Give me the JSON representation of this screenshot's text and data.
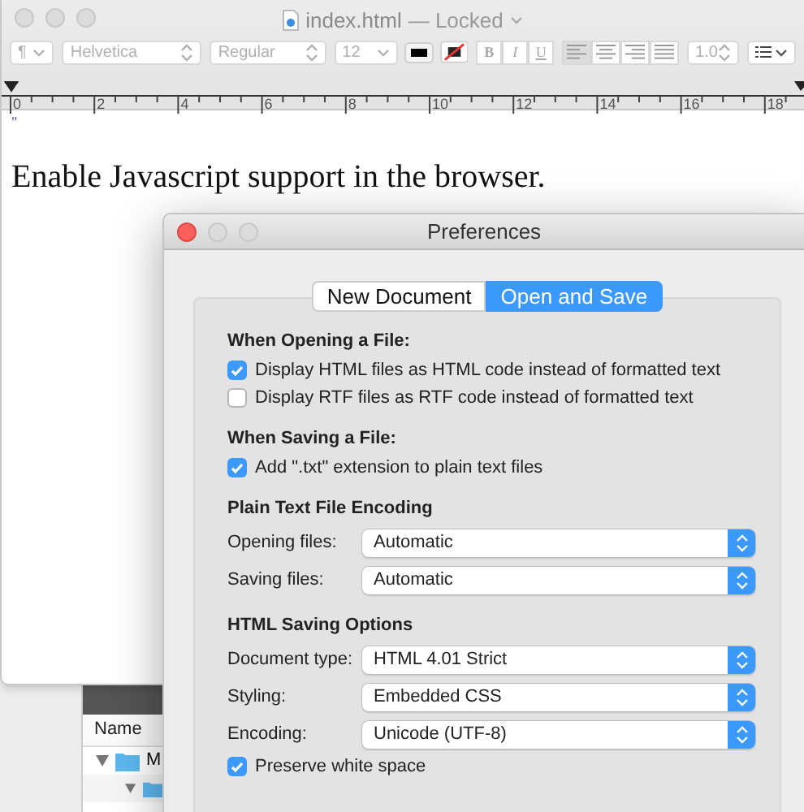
{
  "textedit": {
    "title": "index.html",
    "status": "— Locked",
    "toolbar": {
      "paragraph": "¶",
      "font": "Helvetica",
      "style": "Regular",
      "size": "12",
      "styles": [
        "B",
        "I",
        "U"
      ],
      "alignments": [
        {
          "selected": true
        },
        {
          "selected": false
        },
        {
          "selected": false
        },
        {
          "selected": false
        }
      ],
      "spacing": "1.0"
    },
    "ruler": [
      "0",
      "2",
      "4",
      "6",
      "8",
      "10",
      "12",
      "14",
      "16",
      "18"
    ],
    "lines": [
      "\"",
      "Enable Javascript support in the browser."
    ]
  },
  "finder": {
    "column": "Name",
    "tree": [
      {
        "name": "M",
        "expanded": true,
        "children": [
          {
            "expanded": true
          }
        ]
      }
    ]
  },
  "preferences": {
    "title": "Preferences",
    "tabs": [
      {
        "label": "New Document",
        "selected": false
      },
      {
        "label": "Open and Save",
        "selected": true
      }
    ],
    "sections": [
      {
        "heading": "When Opening a File:",
        "items": [
          {
            "kind": "checkbox",
            "label": "Display HTML files as HTML code instead of formatted text",
            "checked": true
          },
          {
            "kind": "checkbox",
            "label": "Display RTF files as RTF code instead of formatted text",
            "checked": false
          }
        ]
      },
      {
        "heading": "When Saving a File:",
        "items": [
          {
            "kind": "checkbox",
            "label": "Add \".txt\" extension to plain text files",
            "checked": true
          }
        ]
      },
      {
        "heading": "Plain Text File Encoding",
        "items": [
          {
            "kind": "popup",
            "label": "Opening files:",
            "value": "Automatic"
          },
          {
            "kind": "popup",
            "label": "Saving files:",
            "value": "Automatic"
          }
        ]
      },
      {
        "heading": "HTML Saving Options",
        "items": [
          {
            "kind": "popup",
            "label": "Document type:",
            "value": "HTML 4.01 Strict"
          },
          {
            "kind": "popup",
            "label": "Styling:",
            "value": "Embedded CSS"
          },
          {
            "kind": "popup",
            "label": "Encoding:",
            "value": "Unicode (UTF-8)"
          },
          {
            "kind": "checkbox",
            "label": "Preserve white space",
            "checked": true
          }
        ]
      }
    ]
  }
}
